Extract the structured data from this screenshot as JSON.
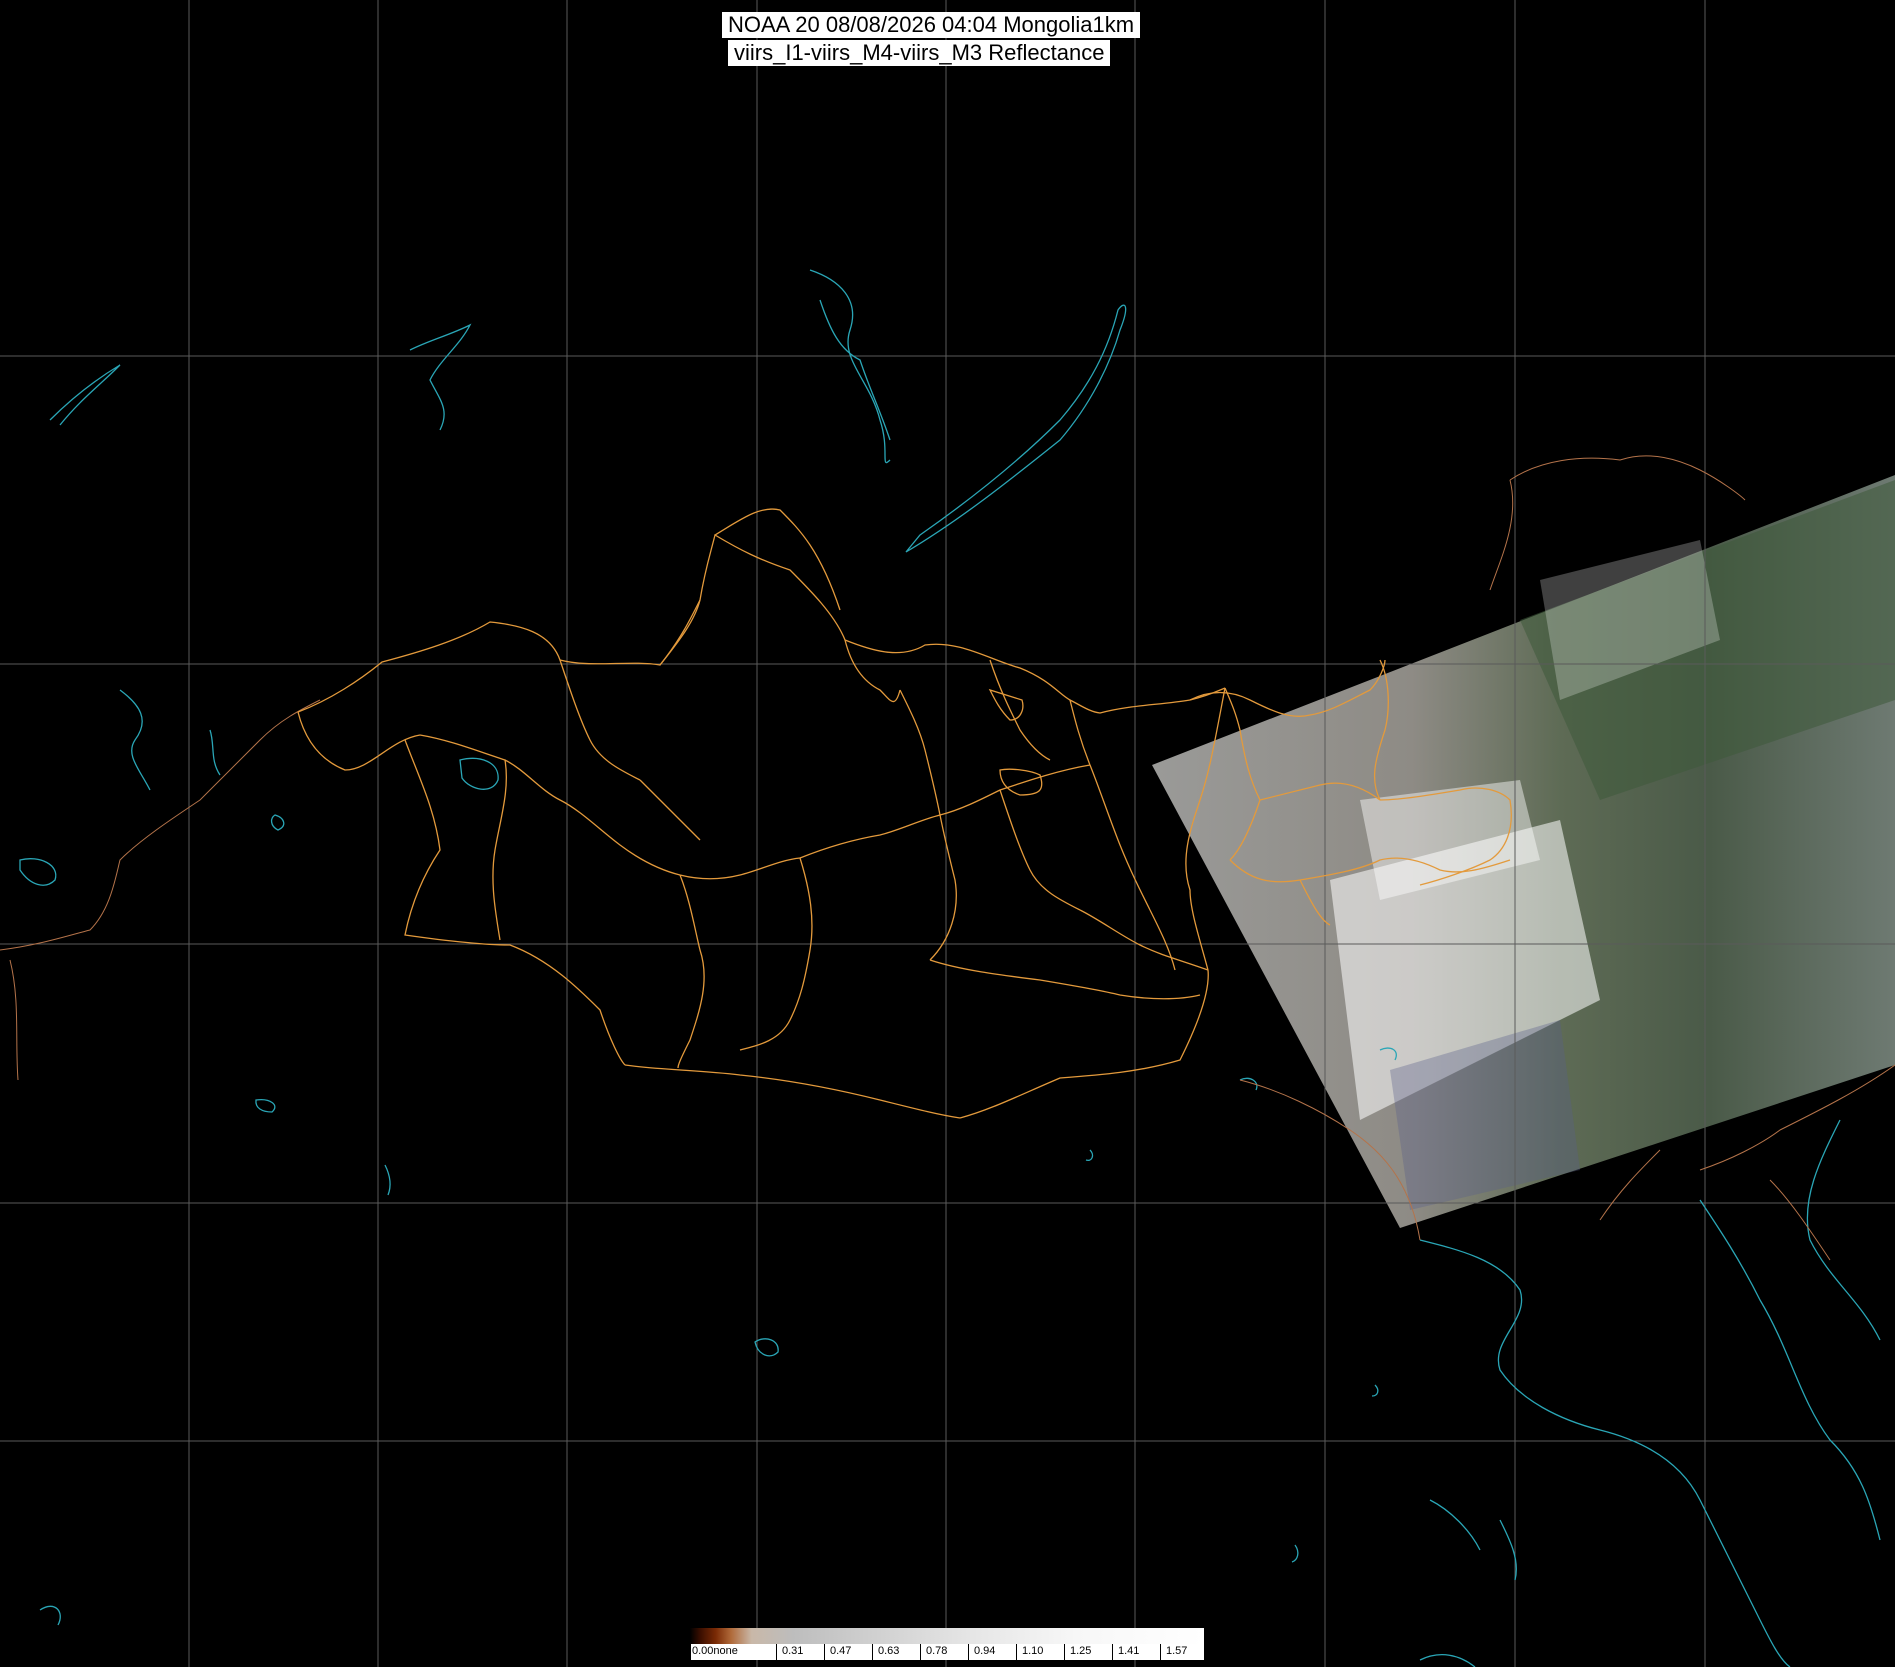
{
  "title": {
    "line1": "NOAA 20 08/08/2026 04:04 Mongolia1km",
    "line2": "viirs_I1-viirs_M4-viirs_M3 Reflectance"
  },
  "colorbar": {
    "labels": [
      "0.00none",
      "0.31",
      "0.47",
      "0.63",
      "0.78",
      "0.94",
      "1.10",
      "1.25",
      "1.41",
      "1.57"
    ]
  },
  "colors": {
    "background": "#000000",
    "grid": "#5a5a5a",
    "provincial_border": "#e39a3c",
    "coastline": "#2aa6b6",
    "country_border": "#b4734a"
  }
}
